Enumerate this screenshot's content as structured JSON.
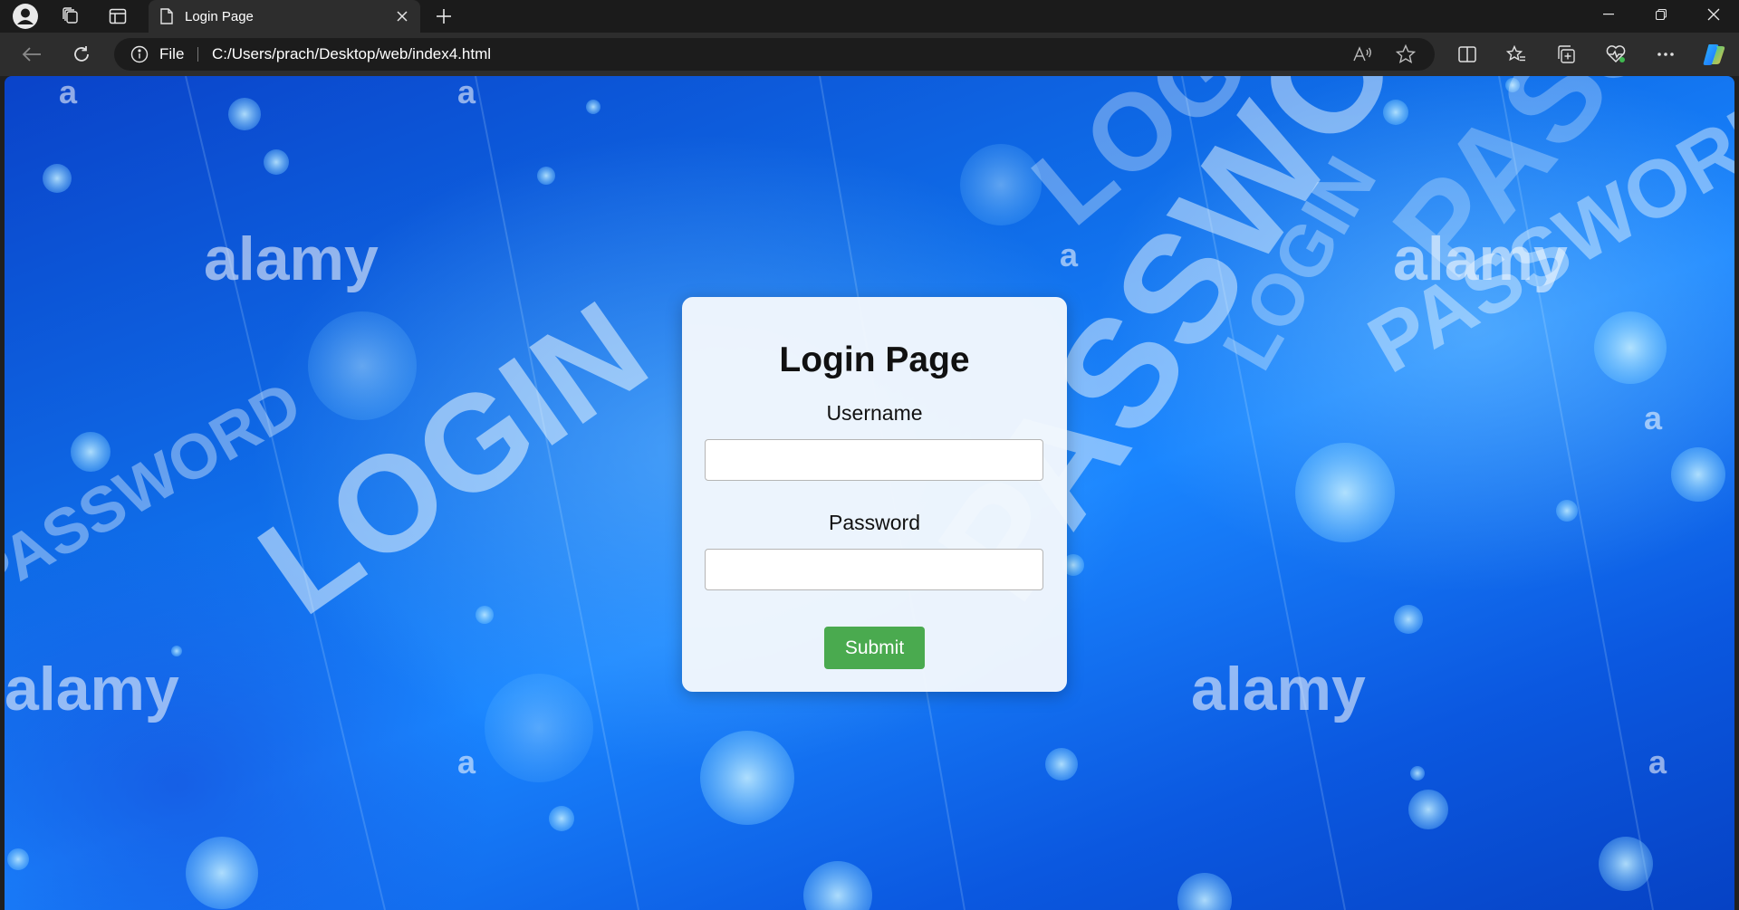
{
  "browser": {
    "tab_title": "Login Page",
    "address_scheme_label": "File",
    "url": "C:/Users/prach/Desktop/web/index4.html",
    "icons": {
      "profile": "profile-icon",
      "workspaces": "workspaces-icon",
      "tab_actions": "tab-actions-icon",
      "new_tab": "plus-icon",
      "back": "back-arrow-icon",
      "refresh": "refresh-icon",
      "site_info": "info-icon",
      "read_aloud": "read-aloud-icon",
      "favorite": "star-icon",
      "split_screen": "split-screen-icon",
      "favorites": "favorites-icon",
      "collections": "collections-icon",
      "browser_essentials": "heart-pulse-icon",
      "more": "more-icon",
      "copilot": "copilot-icon",
      "minimize": "minimize-icon",
      "restore": "restore-icon",
      "close": "close-icon"
    }
  },
  "page": {
    "background_words": [
      "LOGIN",
      "PASSWORD",
      "PASSWORD",
      "LOGIN",
      "PASSWORD",
      "LOGIN",
      "PASSWORD",
      "alamy",
      "alamy",
      "alamy",
      "alamy",
      "a",
      "a",
      "a",
      "a",
      "a",
      "a"
    ],
    "login_card": {
      "title": "Login Page",
      "username_label": "Username",
      "username_value": "",
      "password_label": "Password",
      "password_value": "",
      "submit_label": "Submit"
    }
  },
  "colors": {
    "submit_button": "#4aaa4f",
    "background_primary": "#0f6ce8",
    "card_background": "#f4f8fd"
  }
}
